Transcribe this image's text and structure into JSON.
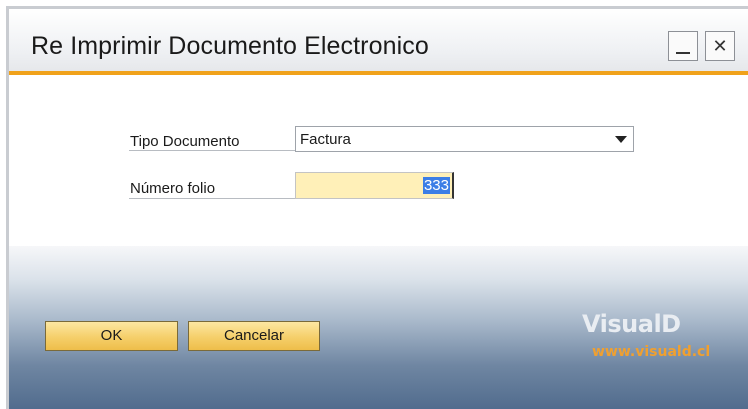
{
  "window": {
    "title": "Re Imprimir Documento Electronico",
    "minimize_icon": "minimize-icon",
    "close_icon": "close-icon",
    "close_glyph": "✕"
  },
  "form": {
    "tipo_documento": {
      "label": "Tipo Documento",
      "selected": "Factura"
    },
    "numero_folio": {
      "label": "Número folio",
      "value": "333"
    }
  },
  "buttons": {
    "ok_label": "OK",
    "cancel_label": "Cancelar"
  },
  "branding": {
    "logo_text": "VisualD",
    "url": "www.visuald.cl"
  },
  "colors": {
    "accent_gold": "#f0a21b",
    "input_highlight": "#fff0b8",
    "selection": "#3c7ee6"
  }
}
